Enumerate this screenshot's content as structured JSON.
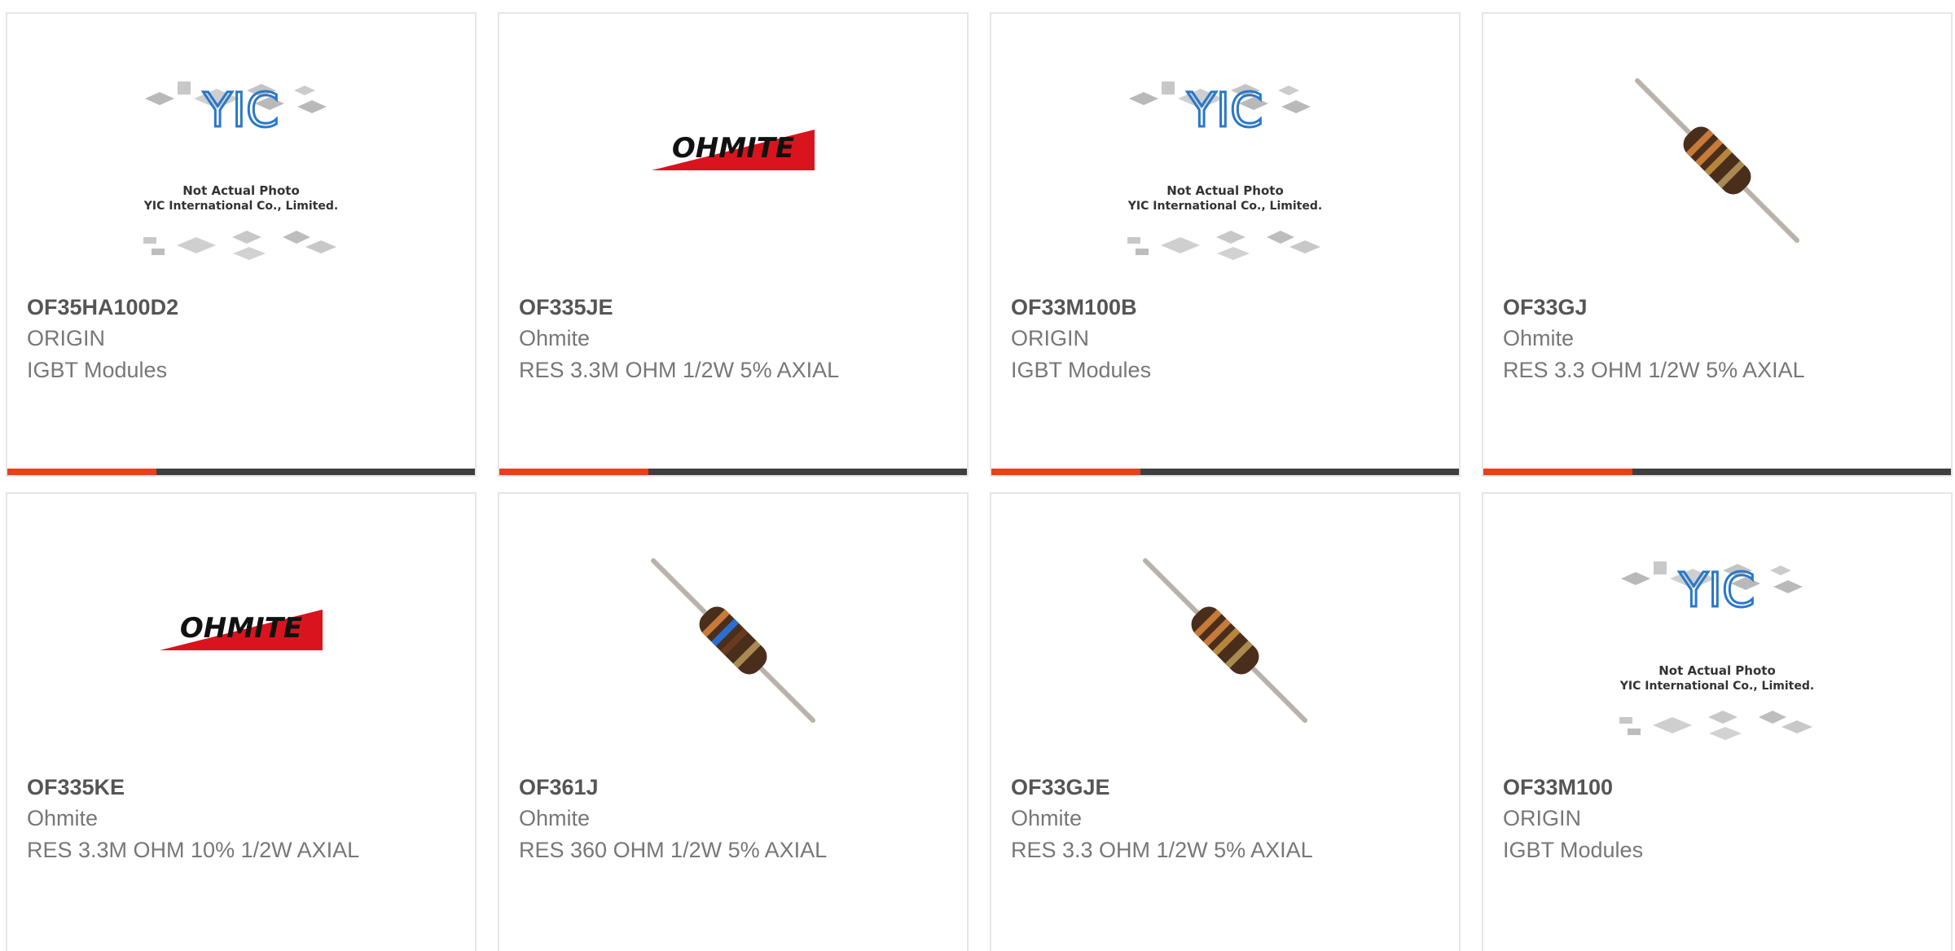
{
  "products": [
    {
      "part_number": "OF35HA100D2",
      "manufacturer": "ORIGIN",
      "description": "IGBT Modules",
      "image": "yic-placeholder-icon",
      "placeholder_text_1": "Not Actual Photo",
      "placeholder_text_2": "YIC International Co., Limited."
    },
    {
      "part_number": "OF335JE",
      "manufacturer": "Ohmite",
      "description": "RES 3.3M OHM 1/2W 5% AXIAL",
      "image": "ohmite-logo",
      "logo_text": "OHMITE"
    },
    {
      "part_number": "OF33M100B",
      "manufacturer": "ORIGIN",
      "description": "IGBT Modules",
      "image": "yic-placeholder-icon",
      "placeholder_text_1": "Not Actual Photo",
      "placeholder_text_2": "YIC International Co., Limited."
    },
    {
      "part_number": "OF33GJ",
      "manufacturer": "Ohmite",
      "description": "RES 3.3 OHM 1/2W 5% AXIAL",
      "image": "resistor-icon"
    },
    {
      "part_number": "OF335KE",
      "manufacturer": "Ohmite",
      "description": "RES 3.3M OHM 10% 1/2W AXIAL",
      "image": "ohmite-logo",
      "logo_text": "OHMITE"
    },
    {
      "part_number": "OF361J",
      "manufacturer": "Ohmite",
      "description": "RES 360 OHM 1/2W 5% AXIAL",
      "image": "resistor-icon"
    },
    {
      "part_number": "OF33GJE",
      "manufacturer": "Ohmite",
      "description": "RES 3.3 OHM 1/2W 5% AXIAL",
      "image": "resistor-icon"
    },
    {
      "part_number": "OF33M100",
      "manufacturer": "ORIGIN",
      "description": "IGBT Modules",
      "image": "yic-placeholder-icon",
      "placeholder_text_1": "Not Actual Photo",
      "placeholder_text_2": "YIC International Co., Limited."
    }
  ],
  "colors": {
    "accent": "#e8401c",
    "bar": "#3f3f3f",
    "yic_blue": "#2a78c8",
    "ohmite_red": "#d9141e"
  }
}
